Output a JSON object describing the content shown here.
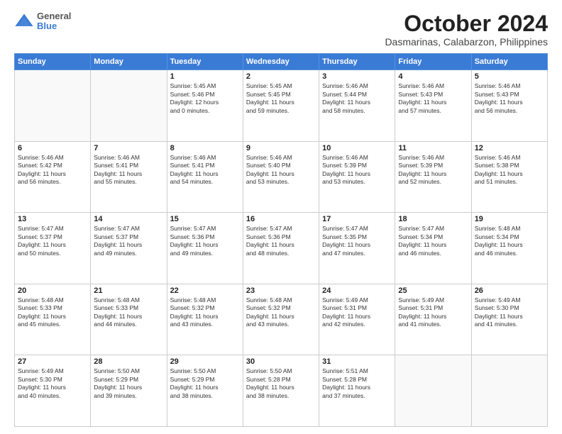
{
  "header": {
    "logo": {
      "general": "General",
      "blue": "Blue"
    },
    "title": "October 2024",
    "location": "Dasmarinas, Calabarzon, Philippines"
  },
  "weekdays": [
    "Sunday",
    "Monday",
    "Tuesday",
    "Wednesday",
    "Thursday",
    "Friday",
    "Saturday"
  ],
  "weeks": [
    [
      {
        "day": "",
        "detail": ""
      },
      {
        "day": "",
        "detail": ""
      },
      {
        "day": "1",
        "detail": "Sunrise: 5:45 AM\nSunset: 5:46 PM\nDaylight: 12 hours\nand 0 minutes."
      },
      {
        "day": "2",
        "detail": "Sunrise: 5:45 AM\nSunset: 5:45 PM\nDaylight: 11 hours\nand 59 minutes."
      },
      {
        "day": "3",
        "detail": "Sunrise: 5:46 AM\nSunset: 5:44 PM\nDaylight: 11 hours\nand 58 minutes."
      },
      {
        "day": "4",
        "detail": "Sunrise: 5:46 AM\nSunset: 5:43 PM\nDaylight: 11 hours\nand 57 minutes."
      },
      {
        "day": "5",
        "detail": "Sunrise: 5:46 AM\nSunset: 5:43 PM\nDaylight: 11 hours\nand 56 minutes."
      }
    ],
    [
      {
        "day": "6",
        "detail": "Sunrise: 5:46 AM\nSunset: 5:42 PM\nDaylight: 11 hours\nand 56 minutes."
      },
      {
        "day": "7",
        "detail": "Sunrise: 5:46 AM\nSunset: 5:41 PM\nDaylight: 11 hours\nand 55 minutes."
      },
      {
        "day": "8",
        "detail": "Sunrise: 5:46 AM\nSunset: 5:41 PM\nDaylight: 11 hours\nand 54 minutes."
      },
      {
        "day": "9",
        "detail": "Sunrise: 5:46 AM\nSunset: 5:40 PM\nDaylight: 11 hours\nand 53 minutes."
      },
      {
        "day": "10",
        "detail": "Sunrise: 5:46 AM\nSunset: 5:39 PM\nDaylight: 11 hours\nand 53 minutes."
      },
      {
        "day": "11",
        "detail": "Sunrise: 5:46 AM\nSunset: 5:39 PM\nDaylight: 11 hours\nand 52 minutes."
      },
      {
        "day": "12",
        "detail": "Sunrise: 5:46 AM\nSunset: 5:38 PM\nDaylight: 11 hours\nand 51 minutes."
      }
    ],
    [
      {
        "day": "13",
        "detail": "Sunrise: 5:47 AM\nSunset: 5:37 PM\nDaylight: 11 hours\nand 50 minutes."
      },
      {
        "day": "14",
        "detail": "Sunrise: 5:47 AM\nSunset: 5:37 PM\nDaylight: 11 hours\nand 49 minutes."
      },
      {
        "day": "15",
        "detail": "Sunrise: 5:47 AM\nSunset: 5:36 PM\nDaylight: 11 hours\nand 49 minutes."
      },
      {
        "day": "16",
        "detail": "Sunrise: 5:47 AM\nSunset: 5:36 PM\nDaylight: 11 hours\nand 48 minutes."
      },
      {
        "day": "17",
        "detail": "Sunrise: 5:47 AM\nSunset: 5:35 PM\nDaylight: 11 hours\nand 47 minutes."
      },
      {
        "day": "18",
        "detail": "Sunrise: 5:47 AM\nSunset: 5:34 PM\nDaylight: 11 hours\nand 46 minutes."
      },
      {
        "day": "19",
        "detail": "Sunrise: 5:48 AM\nSunset: 5:34 PM\nDaylight: 11 hours\nand 46 minutes."
      }
    ],
    [
      {
        "day": "20",
        "detail": "Sunrise: 5:48 AM\nSunset: 5:33 PM\nDaylight: 11 hours\nand 45 minutes."
      },
      {
        "day": "21",
        "detail": "Sunrise: 5:48 AM\nSunset: 5:33 PM\nDaylight: 11 hours\nand 44 minutes."
      },
      {
        "day": "22",
        "detail": "Sunrise: 5:48 AM\nSunset: 5:32 PM\nDaylight: 11 hours\nand 43 minutes."
      },
      {
        "day": "23",
        "detail": "Sunrise: 5:48 AM\nSunset: 5:32 PM\nDaylight: 11 hours\nand 43 minutes."
      },
      {
        "day": "24",
        "detail": "Sunrise: 5:49 AM\nSunset: 5:31 PM\nDaylight: 11 hours\nand 42 minutes."
      },
      {
        "day": "25",
        "detail": "Sunrise: 5:49 AM\nSunset: 5:31 PM\nDaylight: 11 hours\nand 41 minutes."
      },
      {
        "day": "26",
        "detail": "Sunrise: 5:49 AM\nSunset: 5:30 PM\nDaylight: 11 hours\nand 41 minutes."
      }
    ],
    [
      {
        "day": "27",
        "detail": "Sunrise: 5:49 AM\nSunset: 5:30 PM\nDaylight: 11 hours\nand 40 minutes."
      },
      {
        "day": "28",
        "detail": "Sunrise: 5:50 AM\nSunset: 5:29 PM\nDaylight: 11 hours\nand 39 minutes."
      },
      {
        "day": "29",
        "detail": "Sunrise: 5:50 AM\nSunset: 5:29 PM\nDaylight: 11 hours\nand 38 minutes."
      },
      {
        "day": "30",
        "detail": "Sunrise: 5:50 AM\nSunset: 5:28 PM\nDaylight: 11 hours\nand 38 minutes."
      },
      {
        "day": "31",
        "detail": "Sunrise: 5:51 AM\nSunset: 5:28 PM\nDaylight: 11 hours\nand 37 minutes."
      },
      {
        "day": "",
        "detail": ""
      },
      {
        "day": "",
        "detail": ""
      }
    ]
  ]
}
